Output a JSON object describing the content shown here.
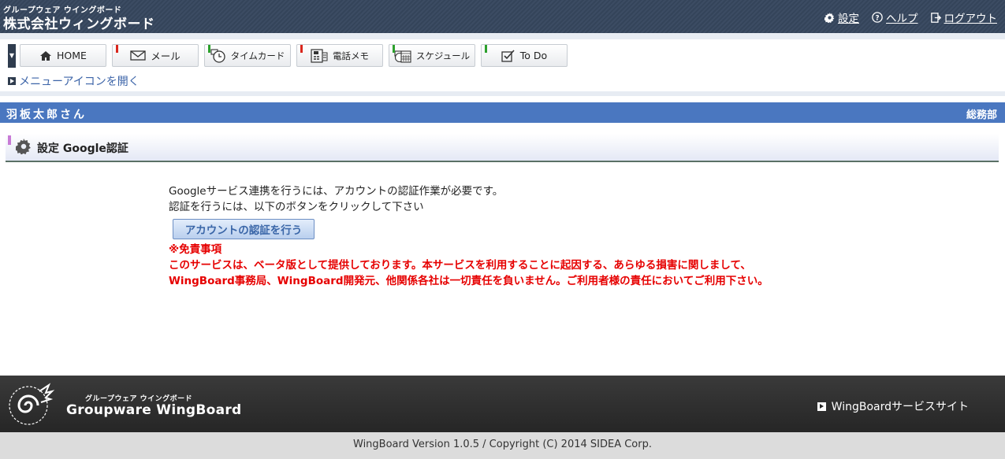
{
  "header": {
    "brand_sub": "グループウェア ウイングボード",
    "brand_main": "株式会社ウィングボード",
    "links": {
      "settings": "設定",
      "help": "ヘルプ",
      "logout": "ログアウト"
    }
  },
  "nav": {
    "items": [
      {
        "label": "HOME",
        "icon": "home-icon",
        "flag": ""
      },
      {
        "label": "メール",
        "icon": "mail-icon",
        "flag": "#d9261c"
      },
      {
        "label": "タイムカード",
        "icon": "clock-icon",
        "flag": "#2ca02c"
      },
      {
        "label": "電話メモ",
        "icon": "phone-memo-icon",
        "flag": "#d9261c"
      },
      {
        "label": "スケジュール",
        "icon": "calendar-icon",
        "flag": "#2ca02c"
      },
      {
        "label": "To Do",
        "icon": "checkbox-icon",
        "flag": "#2ca02c"
      }
    ],
    "open_menu_label": "メニューアイコンを開く"
  },
  "user": {
    "name": "羽板太郎さん",
    "department": "総務部"
  },
  "section": {
    "title": "設定 Google認証"
  },
  "content": {
    "line1": "Googleサービス連携を行うには、アカウントの認証作業が必要です。",
    "line2": "認証を行うには、以下のボタンをクリックして下さい",
    "auth_button": "アカウントの認証を行う",
    "disclaimer_title": "※免責事項",
    "disclaimer_line1": "このサービスは、ベータ版として提供しております。本サービスを利用することに起因する、あらゆる損害に関しまして、",
    "disclaimer_line2": "WingBoard事務局、WingBoard開発元、他関係各社は一切責任を負いません。ご利用者様の責任においてご利用下さい。"
  },
  "footer": {
    "brand_sub": "グループウェア ウイングボード",
    "brand_main": "Groupware WingBoard",
    "service_link": "WingBoardサービスサイト",
    "copyright": "WingBoard Version 1.0.5 / Copyright (C) 2014 SIDEA Corp."
  },
  "colors": {
    "header_bg": "#3c4c63",
    "user_bar": "#4a77c0",
    "disclaimer": "#e60000",
    "link": "#3c64a8"
  }
}
